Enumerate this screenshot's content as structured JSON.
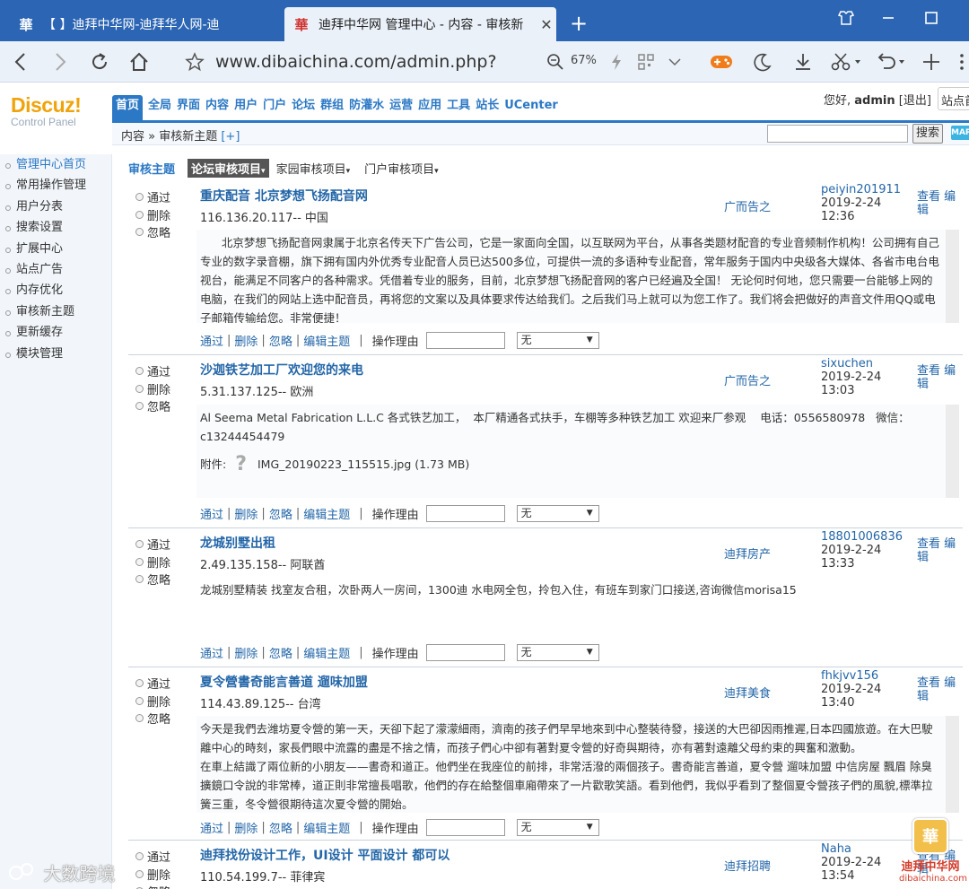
{
  "browser": {
    "tabs": [
      {
        "icon": "華",
        "title": "【        】迪拜中华网-迪拜华人网-迪",
        "close": "✕"
      },
      {
        "icon": "華",
        "title": "迪拜中华网 管理中心 - 内容 - 审核新",
        "close": "✕"
      }
    ],
    "newtab": "+",
    "url": "www.dibaichina.com/admin.php?",
    "zoom": "67%"
  },
  "logo": {
    "main": "Discuz!",
    "sub": "Control Panel"
  },
  "mainnav": [
    "首页",
    "全局",
    "界面",
    "内容",
    "用户",
    "门户",
    "论坛",
    "群组",
    "防灌水",
    "运营",
    "应用",
    "工具",
    "站长",
    "UCenter"
  ],
  "userbar": {
    "greeting": "您好,",
    "user": "admin",
    "logout": "[退出]",
    "site": "站点首页"
  },
  "subbar": {
    "crumb": "内容 » 审核新主题",
    "plus": "[+]",
    "search_btn": "搜索",
    "map": "MAP"
  },
  "sidebar": [
    "管理中心首页",
    "常用操作管理",
    "用户分表",
    "搜索设置",
    "扩展中心",
    "站点广告",
    "内存优化",
    "审核新主题",
    "更新缓存",
    "模块管理"
  ],
  "filter": {
    "label": "审核主题",
    "active": "论坛审核项目",
    "f2": "家园审核项目",
    "f3": "门户审核项目",
    "arrow": "▾"
  },
  "options": [
    "通过",
    "删除",
    "忽略"
  ],
  "actions": {
    "pass": "通过",
    "del": "删除",
    "ignore": "忽略",
    "edit": "编辑主题",
    "sep": "|",
    "reason": "操作理由",
    "select": "无",
    "view": "查看",
    "edit2": "编辑"
  },
  "posts": [
    {
      "title": "重庆配音 北京梦想飞扬配音网",
      "ip": "116.136.20.117-- 中国",
      "forum": "广而告之",
      "author": "peiyin201911",
      "date": "2019-2-24",
      "time": "12:36",
      "body": "      北京梦想飞扬配音网隶属于北京名传天下广告公司，它是一家面向全国，以互联网为平台，从事各类题材配音的专业音频制作机构！公司拥有自己专业的数字录音棚，旗下拥有国内外优秀专业配音人员已达500多位，可提供一流的多语种专业配音，常年服务于国内中央级各大媒体、各省市电台电视台，能满足不同客户的各种需求。凭借着专业的服务，目前，北京梦想飞扬配音网的客户已经遍及全国！ 无论何时何地，您只需要一台能够上网的电脑，在我们的网站上选中配音员，再将您的文案以及具体要求传达给我们。之后我们马上就可以为您工作了。我们将会把做好的声音文件用QQ或电子邮箱传输给您。非常便捷！"
    },
    {
      "title": "沙迦铁艺加工厂欢迎您的来电",
      "ip": "5.31.137.125-- 欧洲",
      "forum": "广而告之",
      "author": "sixuchen",
      "date": "2019-2-24",
      "time": "13:03",
      "body": "Al Seema Metal Fabrication L.L.C 各式铁艺加工，  本厂精通各式扶手，车棚等多种铁艺加工 欢迎来厂参观    电话：0556580978   微信：c13244454479",
      "attach_label": "附件:",
      "attach_icon": "?",
      "attach_file": "IMG_20190223_115515.jpg (1.73 MB)"
    },
    {
      "title": "龙城别墅出租",
      "ip": "2.49.135.158-- 阿联酋",
      "forum": "迪拜房产",
      "author": "18801006836",
      "date": "2019-2-24",
      "time": "13:33",
      "body": "龙城别墅精装 找室友合租，次卧两人一房间，1300迪 水电网全包，拎包入住，有班车到家门口接送,咨询微信morisa15"
    },
    {
      "title": "夏令營書奇能言善道 遛味加盟",
      "ip": "114.43.89.125-- 台湾",
      "forum": "迪拜美食",
      "author": "fhkjvv156",
      "date": "2019-2-24",
      "time": "13:40",
      "body": "今天是我們去潍坊夏令營的第一天，天卻下起了濛濛細雨，濟南的孩子們早早地來到中心整裝待發，接送的大巴卻因雨推遲,日本四國旅遊。在大巴駛離中心的時刻，家長們眼中流露的盡是不捨之情，而孩子們心中卻有著對夏令營的好奇與期待，亦有著對遠離父母約束的興奮和激動。\n在車上結識了兩位新的小朋友——書奇和道正。他們坐在我座位的前排，非常活潑的兩個孩子。書奇能言善道，夏令營 遛味加盟 中信房屋 飄眉 除臭擴鏡口令說的非常棒，道正則非常擅長唱歌，他們的存在給整個車廂帶來了一片歡歌笑語。看到他們，我似乎看到了整個夏令營孩子們的風貌,標準拉簧三重，冬令營很期待這次夏令營的開始。"
    },
    {
      "title": "迪拜找份设计工作，UI设计 平面设计 都可以",
      "ip": "110.54.199.7-- 菲律宾",
      "forum": "迪拜招聘",
      "author": "Naha",
      "date": "2019-2-24",
      "time": "13:54",
      "body": ""
    }
  ],
  "watermarks": {
    "left": "大数跨境",
    "right_logo": "華",
    "right_t1": "迪拜中华网",
    "right_t2": "dibaichina.com"
  },
  "colors": {
    "tabbar": "#2b65b4",
    "navbar": "#eaf1f9",
    "accent": "#2b78c5",
    "link": "#2366a8",
    "logo": "#f0a30a"
  }
}
